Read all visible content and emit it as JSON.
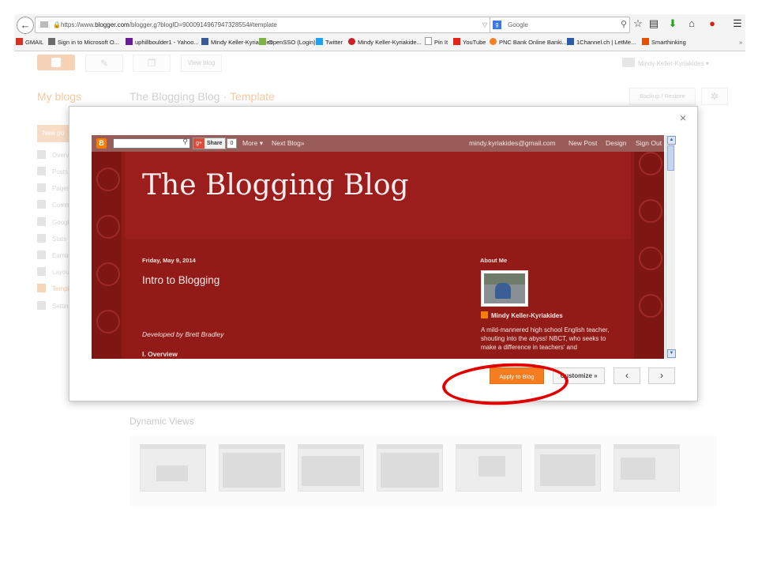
{
  "browser": {
    "url_prefix": "https://www.",
    "url_domain": "blogger.com",
    "url_rest": "/blogger.g?blogID=9000914967947328554#template",
    "search_engine": "Google",
    "search_placeholder": "Google",
    "bookmarks": [
      {
        "label": "GMAIL",
        "color": "#d93025"
      },
      {
        "label": "Sign in to Microsoft O...",
        "color": "#6b6b6b"
      },
      {
        "label": "uphillboulder1 - Yahoo...",
        "color": "#6a1b9a"
      },
      {
        "label": "Mindy Keller-Kyriakides",
        "color": "#3b5998"
      },
      {
        "label": "OpenSSO (Login)",
        "color": "#7cb342"
      },
      {
        "label": "Twitter",
        "color": "#1da1f2"
      },
      {
        "label": "Mindy Keller-Kyriakide...",
        "color": "#cb2027"
      },
      {
        "label": "Pin It",
        "color": "#999999"
      },
      {
        "label": "YouTube",
        "color": "#e62117"
      },
      {
        "label": "PNC Bank Online Banki...",
        "color": "#f58025"
      },
      {
        "label": "1Channel.ch | LetMe...",
        "color": "#2b5aa8"
      },
      {
        "label": "Smarthinking",
        "color": "#e65100"
      }
    ]
  },
  "header": {
    "view_blog": "View blog",
    "user_name": "Mindy Keller-Kyriakides",
    "my_blogs": "My blogs",
    "blog_name": "The Blogging Blog",
    "breadcrumb_sep": "·",
    "section": "Template",
    "backup_restore": "Backup / Restore"
  },
  "sidebar": {
    "new_post": "New po",
    "items": [
      {
        "label": "Overview"
      },
      {
        "label": "Posts"
      },
      {
        "label": "Pages"
      },
      {
        "label": "Comments"
      },
      {
        "label": "Google+"
      },
      {
        "label": "Stats"
      },
      {
        "label": "Earnings"
      },
      {
        "label": "Layout"
      },
      {
        "label": "Template"
      },
      {
        "label": "Settings"
      }
    ]
  },
  "dynamic_views": {
    "heading": "Dynamic Views"
  },
  "modal": {
    "close": "×",
    "preview": {
      "navbar": {
        "logo": "B",
        "share": "Share",
        "share_count": "0",
        "more": "More ▾",
        "next_blog": "Next Blog»",
        "email": "mindy.kyriakides@gmail.com",
        "new_post": "New Post",
        "design": "Design",
        "sign_out": "Sign Out"
      },
      "blog_title": "The Blogging Blog",
      "post_date": "Friday, May 9, 2014",
      "post_title": "Intro to Blogging",
      "developed_by": "Developed by Brett Bradley",
      "overview": "I. Overview",
      "about_heading": "About Me",
      "author": "Mindy Keller-Kyriakides",
      "bio": "A mild-mannered high school English teacher, shouting into the abyss! NBCT, who seeks to make a difference in teachers' and"
    },
    "apply_label": "Apply to Blog",
    "customize_label": "Customize »",
    "prev_label": "‹",
    "next_label": "›"
  }
}
